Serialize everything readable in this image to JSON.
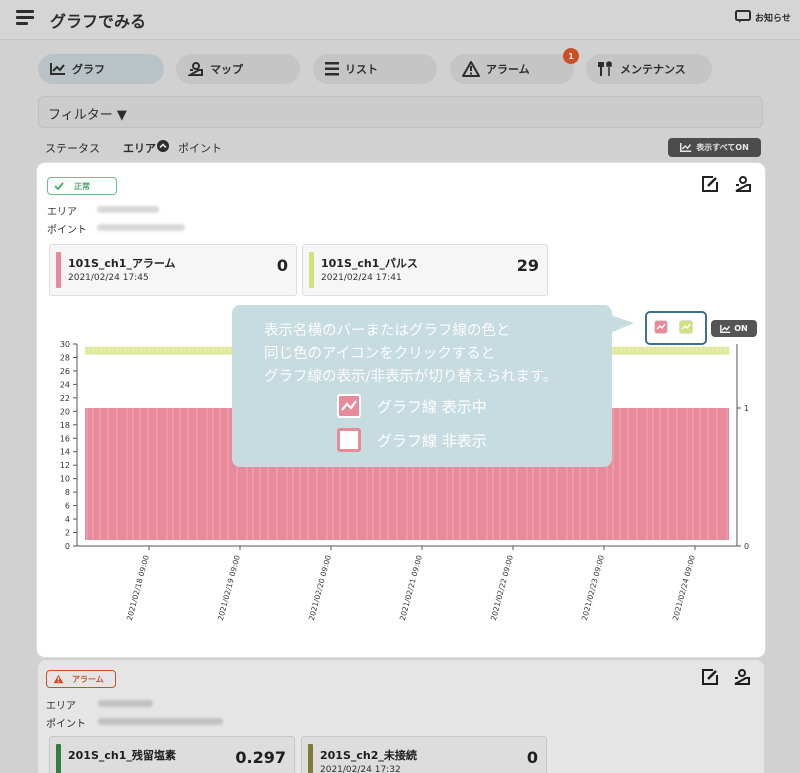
{
  "header": {
    "title": "グラフでみる",
    "notice_label": "お知らせ"
  },
  "tabs": [
    {
      "label": "グラフ",
      "icon": "chart-icon",
      "active": true
    },
    {
      "label": "マップ",
      "icon": "map-pin-icon",
      "active": false
    },
    {
      "label": "リスト",
      "icon": "list-icon",
      "active": false
    },
    {
      "label": "アラーム",
      "icon": "warning-icon",
      "active": false,
      "badge": "1"
    },
    {
      "label": "メンテナンス",
      "icon": "tools-icon",
      "active": false
    }
  ],
  "filter": {
    "label": "フィルター ▼"
  },
  "sort": {
    "status": "ステータス",
    "area": "エリア",
    "point": "ポイント",
    "show_all": "表示すべてON"
  },
  "card1": {
    "status": "正常",
    "area_label": "エリア",
    "point_label": "ポイント",
    "tiles": [
      {
        "name": "101S_ch1_アラーム",
        "time": "2021/02/24 17:45",
        "value": "0",
        "color": "#e88a9a"
      },
      {
        "name": "101S_ch1_パルス",
        "time": "2021/02/24 17:41",
        "value": "29",
        "color": "#d4e07a"
      }
    ],
    "graph_toggle": "ON"
  },
  "callout": {
    "lines": [
      "表示名横のバーまたはグラフ線の色と",
      "同じ色のアイコンをクリックすると",
      "グラフ線の表示/非表示が切り替えられます。"
    ],
    "legend_on": "グラフ線 表示中",
    "legend_off": "グラフ線 非表示"
  },
  "card2": {
    "status": "アラーム",
    "area_label": "エリア",
    "point_label": "ポイント",
    "tiles": [
      {
        "name": "201S_ch1_残留塩素",
        "value": "0.297",
        "color": "#3d8b4a"
      },
      {
        "name": "201S_ch2_未接続",
        "time": "2021/02/24 17:32",
        "value": "0",
        "color": "#8b8b3d"
      }
    ]
  },
  "chart_data": {
    "type": "bar",
    "title": "",
    "x_ticks": [
      "2021/02/18 09:00",
      "2021/02/19 09:00",
      "2021/02/20 09:00",
      "2021/02/21 09:00",
      "2021/02/22 09:00",
      "2021/02/23 09:00",
      "2021/02/24 09:00"
    ],
    "y_ticks_left": [
      0,
      2,
      4,
      6,
      8,
      10,
      12,
      14,
      16,
      18,
      20,
      22,
      24,
      26,
      28,
      30
    ],
    "y_ticks_right": [
      0,
      1
    ],
    "ylim_left": [
      0,
      30
    ],
    "ylim_right": [
      0,
      1
    ],
    "series": [
      {
        "name": "101S_ch1_アラーム",
        "axis": "right",
        "color": "#e88a9a",
        "value": 1,
        "style": "bars"
      },
      {
        "name": "101S_ch1_パルス",
        "axis": "left",
        "color": "#d4e07a",
        "value": 29,
        "style": "line"
      }
    ]
  }
}
